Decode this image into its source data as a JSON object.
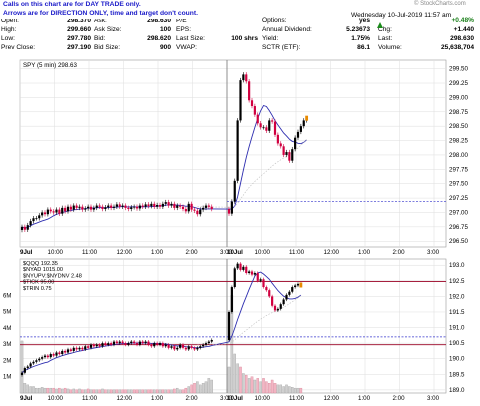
{
  "note_lines": [
    "Calls on this chart are for DAY TRADE only.",
    "Arrows are for DIRECTION ONLY, time and target don't count."
  ],
  "watermark": "© StockCharts.com",
  "date_line": "Wednesday 10-Jul-2019 11:57 am",
  "quote": {
    "col1": [
      [
        "Open:",
        "298.370"
      ],
      [
        "High:",
        "299.660"
      ],
      [
        "Low:",
        "297.780"
      ],
      [
        "Prev Close:",
        "297.190"
      ]
    ],
    "col2": [
      [
        "Ask:",
        "298.630"
      ],
      [
        "Ask Size:",
        "100"
      ],
      [
        "Bid:",
        "298.620"
      ],
      [
        "Bid Size:",
        "900"
      ]
    ],
    "col3": [
      [
        "P/E",
        ""
      ],
      [
        "EPS:",
        ""
      ],
      [
        "Last Size:",
        "100 shrs"
      ],
      [
        "VWAP:",
        ""
      ]
    ],
    "col4": [
      [
        "Options:",
        "yes"
      ],
      [
        "Annual Dividend:",
        "5.23673"
      ],
      [
        "Yield:",
        "1.75%"
      ],
      [
        "SCTR (ETF):",
        "86.1"
      ]
    ],
    "col5": [
      [
        "",
        "+0.48%"
      ],
      [
        "Chg:",
        "+1.440"
      ],
      [
        "Last:",
        "298.630"
      ],
      [
        "Volume:",
        "25,638,704"
      ]
    ]
  },
  "colors": {
    "up": "#000000",
    "down": "#d10040",
    "ma": "#2e2eb0",
    "guide_blue": "#3333cc",
    "guide_red": "#990022",
    "grid": "#dddddd"
  },
  "chart_data": [
    {
      "type": "candlestick",
      "legend": "SPY (5 min) 298.63",
      "y_ticks": [
        "296.50",
        "296.75",
        "297.00",
        "297.25",
        "297.50",
        "297.75",
        "298.00",
        "298.25",
        "298.50",
        "298.75",
        "299.00",
        "299.25",
        "299.50"
      ],
      "ylim": [
        296.4,
        299.65
      ],
      "x_ticks": [
        "9Jul",
        "10:00",
        "11:00",
        "12:00",
        "1:00",
        "2:00",
        "3:00",
        "10Jul",
        "10:00",
        "11:00",
        "12:00",
        "1:00",
        "2:00",
        "3:00"
      ],
      "close": [
        296.75,
        296.7,
        296.78,
        296.85,
        296.9,
        296.9,
        296.95,
        297.0,
        296.97,
        297.05,
        297.02,
        297.0,
        297.05,
        296.98,
        297.08,
        297.02,
        297.1,
        297.05,
        297.12,
        297.08,
        297.1,
        297.05,
        297.07,
        297.1,
        297.05,
        297.08,
        297.12,
        297.1,
        297.06,
        297.09,
        297.12,
        297.08,
        297.1,
        297.14,
        297.1,
        297.12,
        297.08,
        297.06,
        297.09,
        297.1,
        297.07,
        297.12,
        297.1,
        297.14,
        297.11,
        297.15,
        297.1,
        297.13,
        297.1,
        297.15,
        297.18,
        297.12,
        297.15,
        297.08,
        297.12,
        297.1,
        297.06,
        297.02,
        297.15,
        297.05,
        297.03,
        296.97,
        297.05,
        297.08,
        297.12,
        297.1,
        297.06,
        296.98,
        297.19,
        297.55,
        298.6,
        299.3,
        299.4,
        299.28,
        298.95,
        298.85,
        298.7,
        298.55,
        298.48,
        298.48,
        298.42,
        298.6,
        298.58,
        298.35,
        298.2,
        298.15,
        298.0,
        298.05,
        297.9,
        298.1,
        298.3,
        298.4,
        298.5,
        298.6,
        298.63
      ],
      "guides": [
        {
          "value": 297.19,
          "label": "prev close"
        }
      ]
    },
    {
      "type": "candlestick",
      "legend": [
        "$QQQ 192.35",
        "$NYAD 1015.00",
        "$NYUPV:$NYDNV 2.48",
        "$TICK 95.00",
        "$TRIN 0.75"
      ],
      "y_ticks_right": [
        "189.0",
        "189.5",
        "190.0",
        "190.5",
        "191.0",
        "191.5",
        "192.0",
        "192.5",
        "193.0"
      ],
      "y_ticks_left": [
        "1M",
        "2M",
        "3M",
        "4M",
        "5M",
        "6M"
      ],
      "ylim": [
        188.9,
        193.2
      ],
      "x_ticks": [
        "9Jul",
        "10:00",
        "11:00",
        "12:00",
        "1:00",
        "2:00",
        "3:00",
        "10Jul",
        "10:00",
        "11:00",
        "12:00",
        "1:00",
        "2:00",
        "3:00"
      ],
      "close": [
        189.55,
        189.7,
        189.75,
        189.85,
        189.9,
        189.95,
        190.0,
        190.05,
        190.1,
        190.05,
        190.15,
        190.1,
        190.2,
        190.15,
        190.25,
        190.2,
        190.3,
        190.25,
        190.35,
        190.3,
        190.35,
        190.3,
        190.4,
        190.35,
        190.45,
        190.4,
        190.45,
        190.4,
        190.5,
        190.45,
        190.5,
        190.45,
        190.55,
        190.5,
        190.55,
        190.5,
        190.45,
        190.5,
        190.55,
        190.5,
        190.45,
        190.55,
        190.5,
        190.55,
        190.45,
        190.4,
        190.5,
        190.45,
        190.5,
        190.4,
        190.45,
        190.35,
        190.4,
        190.3,
        190.35,
        190.45,
        190.35,
        190.3,
        190.4,
        190.35,
        190.3,
        190.35,
        190.4,
        190.45,
        190.5,
        190.55,
        190.6,
        191.5,
        192.3,
        192.9,
        193.05,
        192.85,
        192.95,
        192.75,
        192.8,
        192.7,
        192.75,
        192.5,
        192.55,
        192.3,
        192.2,
        192.0,
        191.7,
        191.55,
        191.6,
        191.75,
        191.9,
        192.05,
        192.15,
        192.3,
        192.35,
        192.4,
        192.35
      ],
      "volume": [
        3.2,
        0.6,
        0.5,
        0.4,
        0.4,
        0.3,
        0.3,
        0.35,
        0.3,
        0.3,
        0.3,
        0.3,
        0.25,
        0.3,
        0.25,
        0.3,
        0.25,
        0.2,
        0.25,
        0.2,
        0.25,
        0.2,
        0.2,
        0.25,
        0.2,
        0.2,
        0.2,
        0.2,
        0.25,
        0.2,
        0.2,
        0.2,
        0.2,
        0.2,
        0.2,
        0.2,
        0.2,
        0.2,
        0.2,
        0.2,
        0.2,
        0.2,
        0.2,
        0.2,
        0.2,
        0.2,
        0.2,
        0.2,
        0.2,
        0.2,
        0.2,
        0.2,
        0.2,
        0.25,
        0.3,
        0.2,
        0.2,
        0.3,
        0.4,
        0.5,
        0.6,
        0.7,
        0.5,
        0.6,
        0.7,
        0.9,
        0.8,
        1.6,
        6.0,
        2.4,
        1.8,
        1.6,
        1.2,
        1.1,
        0.9,
        1.0,
        0.8,
        0.9,
        0.7,
        0.9,
        0.7,
        0.6,
        0.8,
        0.6,
        0.5,
        0.5,
        0.4,
        0.5,
        0.4,
        0.35,
        0.3,
        0.3,
        0.3
      ],
      "guides": [
        {
          "value": 190.7,
          "label": "dotted"
        },
        {
          "value": 190.45,
          "label": "solid"
        },
        {
          "value": 192.48,
          "label": "solid"
        }
      ]
    }
  ]
}
